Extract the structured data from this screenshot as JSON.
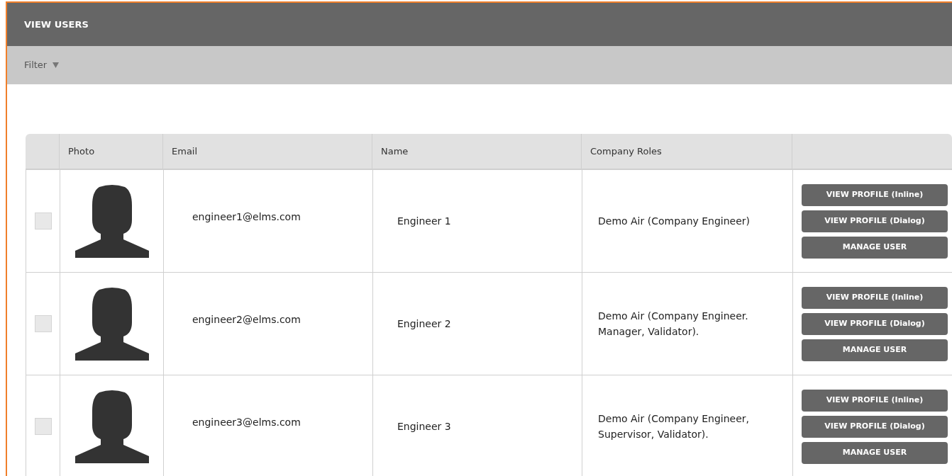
{
  "header": {
    "title": "VIEW USERS"
  },
  "filter": {
    "label": "Filter",
    "expanded": false
  },
  "table": {
    "columns": [
      "Photo",
      "Email",
      "Name",
      "Company Roles"
    ],
    "rows": [
      {
        "checked": false,
        "email": "engineer1@elms.com",
        "name": "Engineer 1",
        "roles": "Demo Air (Company Engineer)",
        "actions": [
          "VIEW PROFILE (Inline)",
          "VIEW PROFILE (Dialog)",
          "MANAGE USER"
        ]
      },
      {
        "checked": false,
        "email": "engineer2@elms.com",
        "name": "Engineer 2",
        "roles": "Demo Air (Company Engineer. Manager, Validator).",
        "actions": [
          "VIEW PROFILE (Inline)",
          "VIEW PROFILE (Dialog)",
          "MANAGE USER"
        ]
      },
      {
        "checked": false,
        "email": "engineer3@elms.com",
        "name": "Engineer 3",
        "roles": "Demo Air (Company Engineer, Supervisor, Validator).",
        "actions": [
          "VIEW PROFILE (Inline)",
          "VIEW PROFILE (Dialog)",
          "MANAGE USER"
        ]
      }
    ]
  }
}
